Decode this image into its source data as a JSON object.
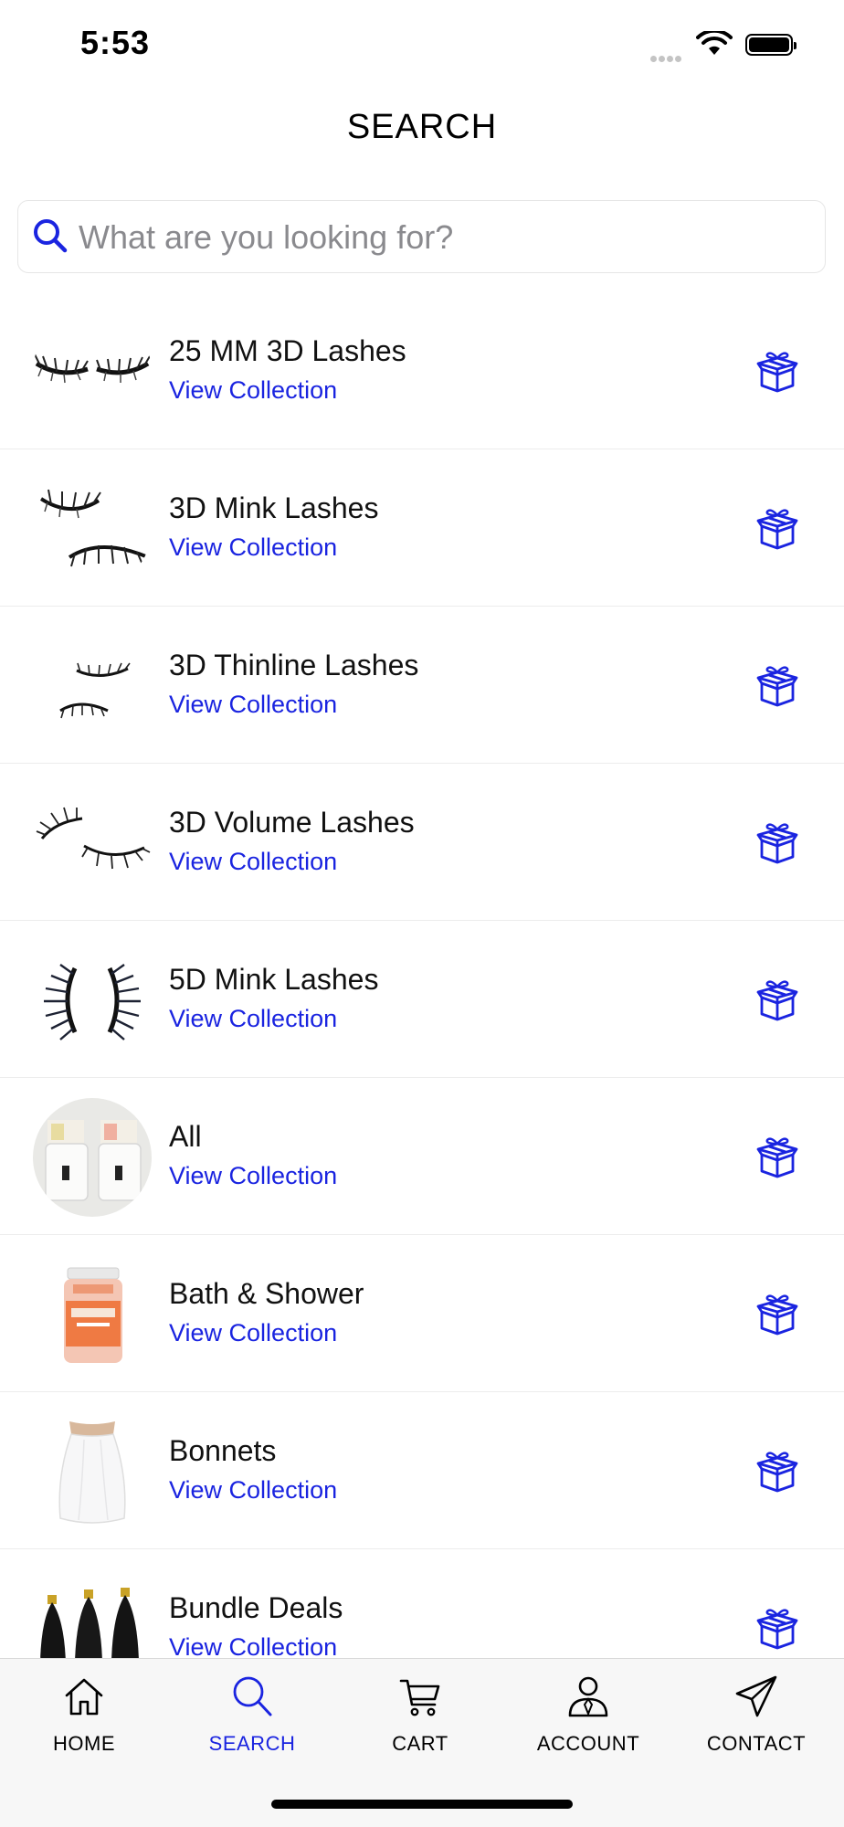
{
  "status_bar": {
    "time": "5:53"
  },
  "header": {
    "title": "SEARCH"
  },
  "search": {
    "placeholder": "What are you looking for?",
    "value": ""
  },
  "collections": [
    {
      "title": "25 MM 3D Lashes",
      "link": "View Collection",
      "thumb": "lashes-thumbnail"
    },
    {
      "title": "3D Mink Lashes",
      "link": "View Collection",
      "thumb": "lashes-thumbnail"
    },
    {
      "title": "3D Thinline Lashes",
      "link": "View Collection",
      "thumb": "lashes-thumbnail"
    },
    {
      "title": "3D Volume Lashes",
      "link": "View Collection",
      "thumb": "lashes-thumbnail"
    },
    {
      "title": "5D Mink Lashes",
      "link": "View Collection",
      "thumb": "lashes-thumbnail"
    },
    {
      "title": "All",
      "link": "View Collection",
      "thumb": "candles-thumbnail"
    },
    {
      "title": "Bath & Shower",
      "link": "View Collection",
      "thumb": "bath-salt-jar-thumbnail"
    },
    {
      "title": "Bonnets",
      "link": "View Collection",
      "thumb": "bonnet-thumbnail"
    },
    {
      "title": "Bundle Deals",
      "link": "View Collection",
      "thumb": "hair-bundles-thumbnail"
    }
  ],
  "tabbar": {
    "home": "HOME",
    "search": "SEARCH",
    "cart": "CART",
    "account": "ACCOUNT",
    "contact": "CONTACT",
    "active": "search"
  },
  "colors": {
    "accent": "#1a24e0",
    "divider": "#ececec",
    "tabbar_bg": "#f7f7f7"
  }
}
